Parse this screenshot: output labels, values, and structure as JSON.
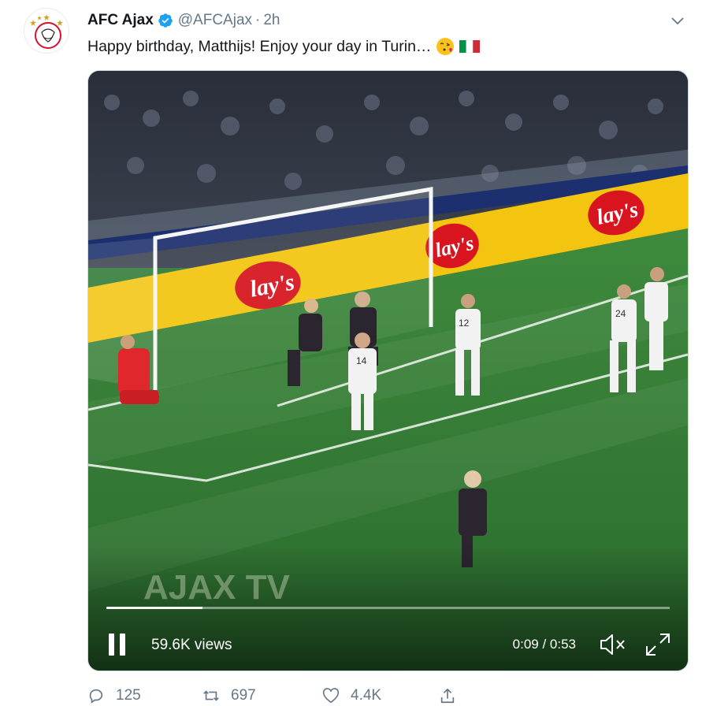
{
  "tweet": {
    "author_name": "AFC Ajax",
    "handle": "@AFCAjax",
    "separator": "·",
    "time": "2h",
    "text": "Happy birthday, Matthijs! Enjoy your day in Turin…",
    "emojis": [
      "face-blowing-a-kiss-emoji",
      "italy-flag-emoji"
    ]
  },
  "media": {
    "views_label": "59.6K views",
    "time_label": "0:09 / 0:53",
    "progress": 0.17,
    "watermark": "AJAX TV",
    "board_text": "lay's",
    "shirt_numbers": [
      "12",
      "24",
      "14"
    ]
  },
  "actions": {
    "replies": "125",
    "retweets": "697",
    "likes": "4.4K"
  },
  "colors": {
    "verified": "#1da1f2",
    "secondary_text": "#657786",
    "ajax_red": "#d2122e",
    "pitch": "#2f7a35"
  },
  "icons": {
    "reply": "reply-icon",
    "retweet": "retweet-icon",
    "like": "like-icon",
    "share": "share-icon",
    "caret": "chevron-down-icon",
    "pause": "pause-icon",
    "mute": "mute-icon",
    "fullscreen": "fullscreen-icon"
  }
}
